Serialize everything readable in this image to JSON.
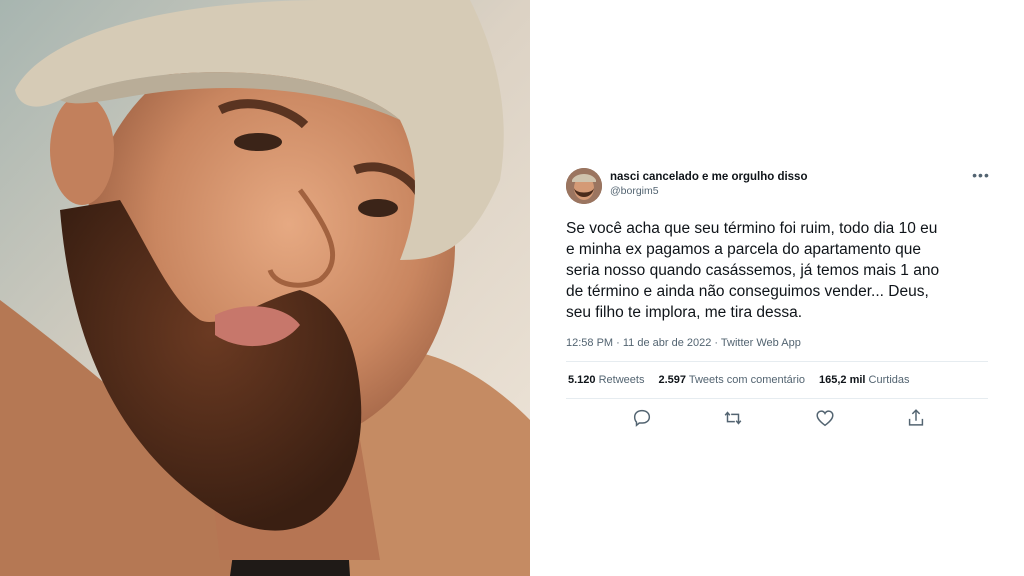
{
  "tweet": {
    "display_name": "nasci cancelado e me orgulho disso",
    "handle": "@borgim5",
    "more_label": "•••",
    "text": "Se você acha que seu término foi ruim, todo dia 10 eu\ne minha ex pagamos a parcela do apartamento que\nseria nosso quando casássemos, já temos mais 1 ano\nde término e ainda não conseguimos vender... Deus,\nseu filho te implora, me tira dessa.",
    "meta": "12:58 PM · 11 de abr de 2022 · Twitter Web App",
    "stats": {
      "retweets_count": "5.120",
      "retweets_label": "Retweets",
      "quotes_count": "2.597",
      "quotes_label": "Tweets com comentário",
      "likes_count": "165,2 mil",
      "likes_label": "Curtidas"
    },
    "actions": [
      "reply-icon",
      "retweet-icon",
      "like-icon",
      "share-icon"
    ]
  },
  "colors": {
    "text": "#0f1419",
    "secondary": "#536471",
    "rule": "#e6ecf0"
  }
}
